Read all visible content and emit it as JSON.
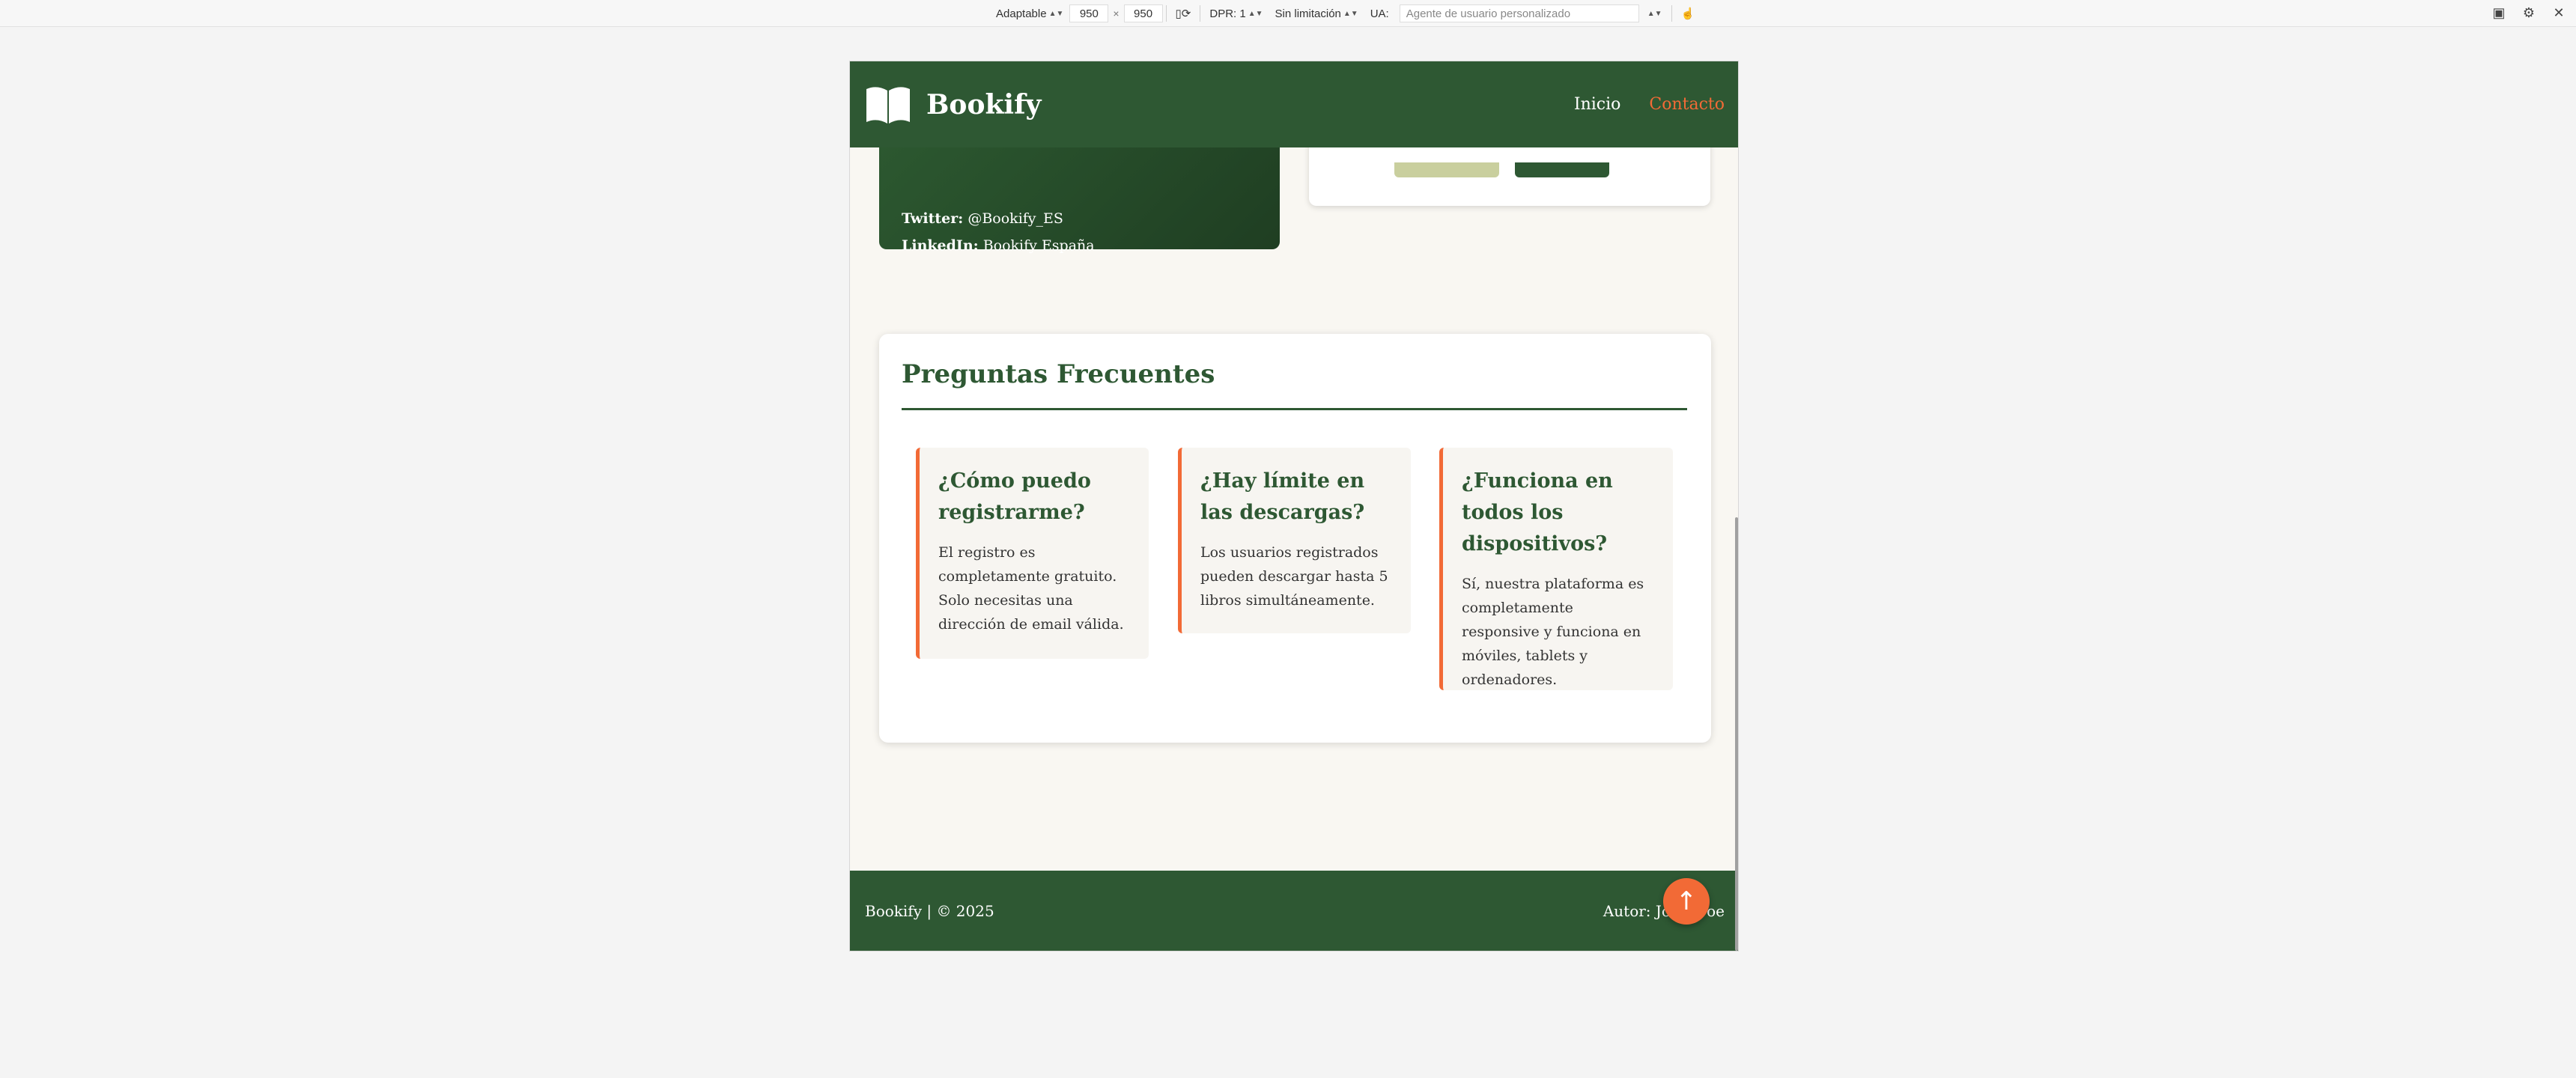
{
  "toolbar": {
    "device": "Adaptable",
    "width": "950",
    "times": "×",
    "height": "950",
    "dpr": "DPR: 1",
    "throttle": "Sin limitación",
    "ua_label": "UA:",
    "ua_placeholder": "Agente de usuario personalizado"
  },
  "site": {
    "brand": "Bookify",
    "nav": [
      {
        "label": "Inicio"
      },
      {
        "label": "Contacto"
      }
    ],
    "social": {
      "twitter_label": "Twitter:",
      "twitter_value": "@Bookify_ES",
      "linkedin_label": "LinkedIn:",
      "linkedin_value": "Bookify España"
    },
    "faq": {
      "title": "Preguntas Frecuentes",
      "items": [
        {
          "q": "¿Cómo puedo registrarme?",
          "a": "El registro es completamente gratuito. Solo necesitas una dirección de email válida."
        },
        {
          "q": "¿Hay límite en las descargas?",
          "a": "Los usuarios registrados pueden descargar hasta 5 libros simultáneamente."
        },
        {
          "q": "¿Funciona en todos los dispositivos?",
          "a": "Sí, nuestra plataforma es completamente responsive y funciona en móviles, tablets y ordenadores."
        }
      ]
    },
    "footer": {
      "left": "Bookify | © 2025",
      "right": "Autor: John Doe"
    },
    "scroll_top_glyph": "↑"
  },
  "colors": {
    "primary": "#2e5833",
    "accent": "#f26a36",
    "background": "#f9f7f2"
  }
}
